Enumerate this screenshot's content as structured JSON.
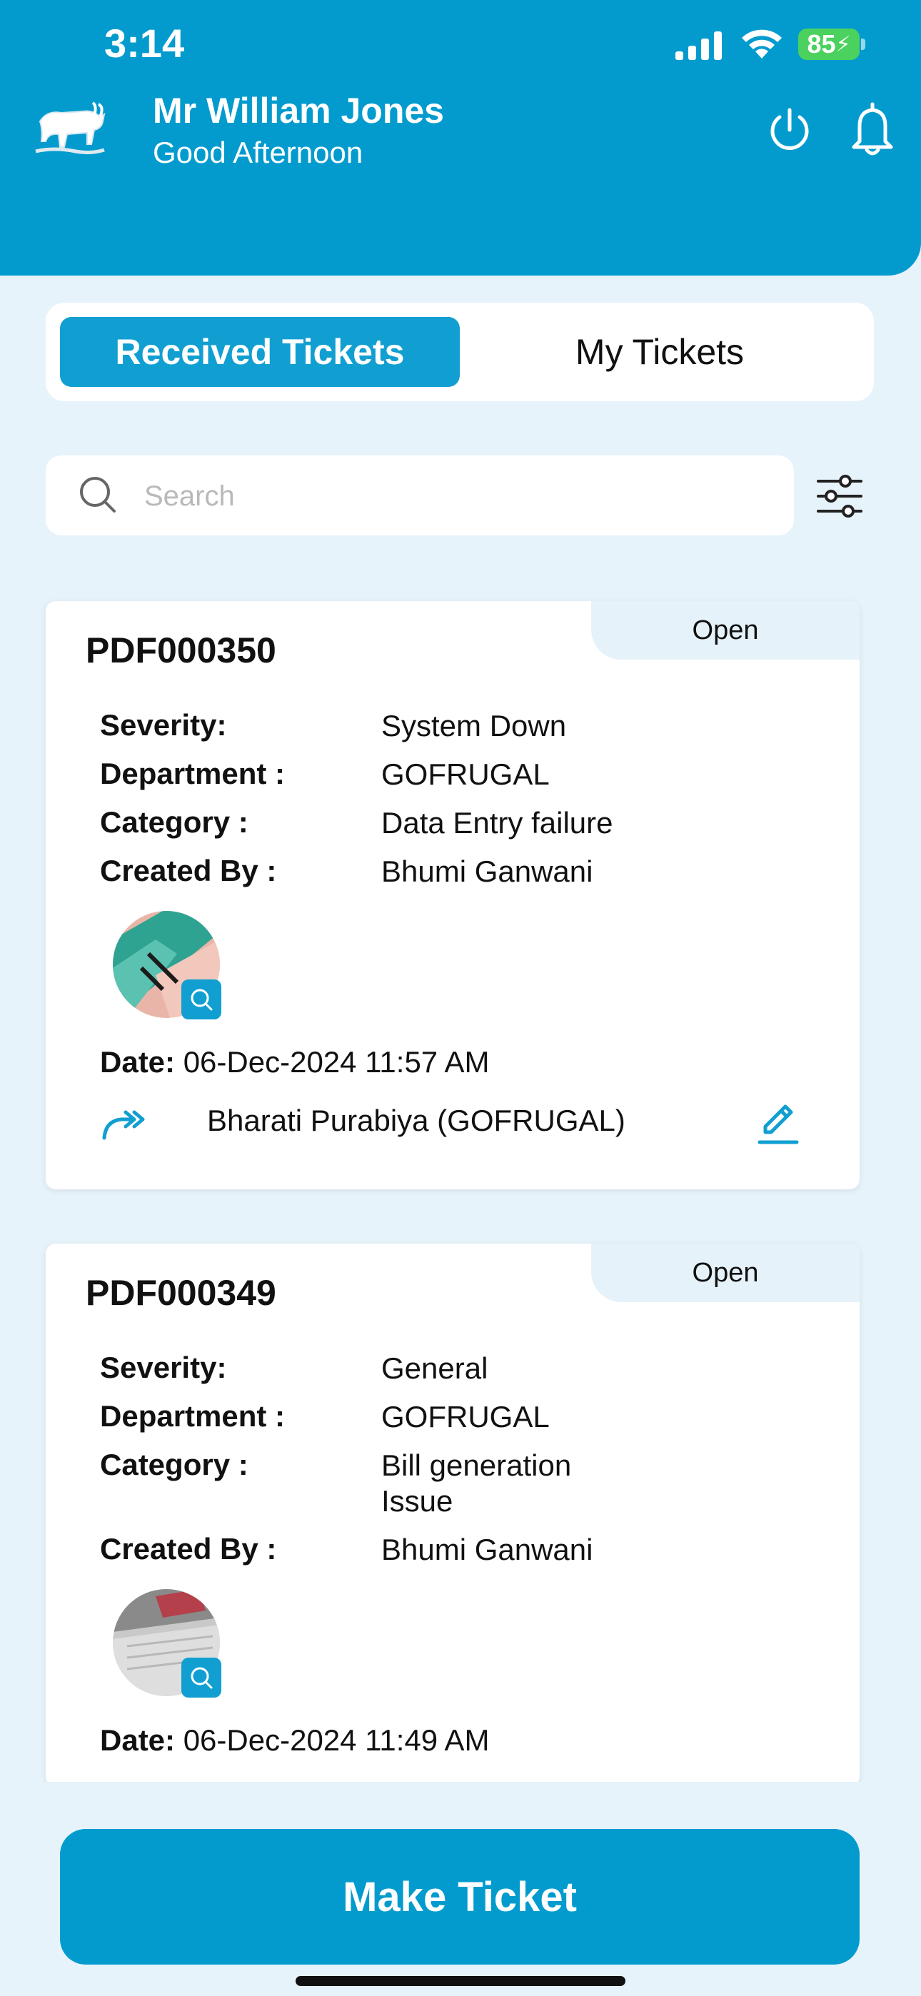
{
  "status_bar": {
    "time": "3:14",
    "battery": "85"
  },
  "header": {
    "user_name": "Mr William Jones",
    "greeting": "Good Afternoon",
    "icons": [
      "logo-bull-icon",
      "power-icon",
      "bell-icon"
    ]
  },
  "tabs": {
    "received": "Received Tickets",
    "mine": "My Tickets",
    "active": "received"
  },
  "search": {
    "placeholder": "Search"
  },
  "labels": {
    "severity": "Severity:",
    "department": "Department :",
    "category": "Category :",
    "created_by": "Created By :",
    "date": "Date:"
  },
  "tickets": [
    {
      "id": "PDF000350",
      "status": "Open",
      "severity": "System Down",
      "department": "GOFRUGAL",
      "category": "Data Entry failure",
      "created_by": "Bhumi  Ganwani",
      "date": "06-Dec-2024 11:57 AM",
      "assignee": "Bharati  Purabiya (GOFRUGAL)"
    },
    {
      "id": "PDF000349",
      "status": "Open",
      "severity": "General",
      "department": "GOFRUGAL",
      "category": "Bill generation Issue",
      "created_by": "Bhumi  Ganwani",
      "date": "06-Dec-2024 11:49 AM"
    }
  ],
  "actions": {
    "make_ticket": "Make Ticket"
  },
  "colors": {
    "primary": "#039bce",
    "background": "#e7f3fb",
    "badge": "#e6f2fa"
  }
}
